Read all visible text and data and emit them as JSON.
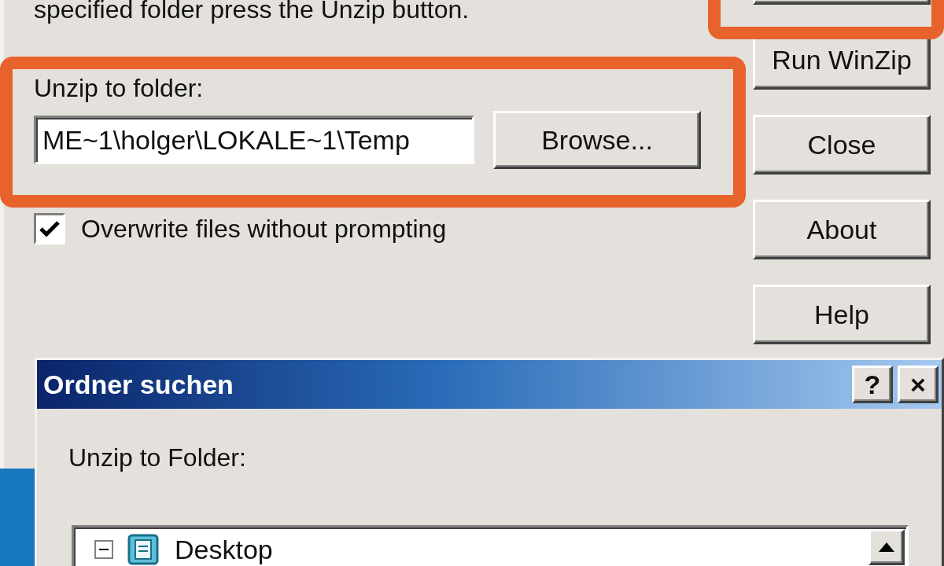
{
  "instruction_text": "specified folder press the Unzip button.",
  "folder_field": {
    "label": "Unzip to folder:",
    "value": "ME~1\\holger\\LOKALE~1\\Temp"
  },
  "browse_button": "Browse...",
  "overwrite": {
    "label": "Overwrite files without prompting",
    "checked": true
  },
  "side_buttons": [
    {
      "label": "Run WinZip"
    },
    {
      "label": "Close"
    },
    {
      "label": "About"
    },
    {
      "label": "Help"
    }
  ],
  "browse_dialog": {
    "title": "Ordner suchen",
    "title_buttons": [
      {
        "label": "?"
      },
      {
        "label": "×"
      }
    ],
    "prompt": "Unzip to Folder:",
    "tree": [
      {
        "label": "Desktop",
        "expanded": true
      }
    ]
  }
}
